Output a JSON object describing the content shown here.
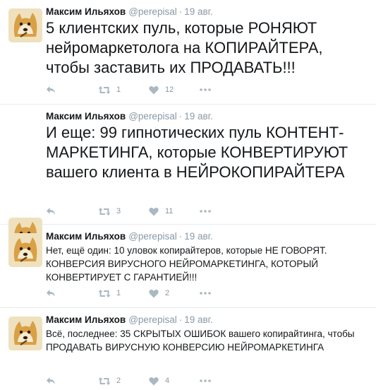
{
  "colors": {
    "meta": "#8899a6",
    "text": "#14171a",
    "divider": "#e6ecf0",
    "action": "#aab8c2"
  },
  "tweets": [
    {
      "author": "Максим Ильяхов",
      "handle": "@perepisal",
      "separator": "·",
      "date": "19 авг.",
      "text": "5 клиентских пуль, которые РОНЯЮТ нейромаркетолога на КОПИРАЙТЕРА, чтобы заставить их ПРОДАВАТЬ!!!",
      "retweets": "1",
      "likes": "12"
    },
    {
      "author": "Максим Ильяхов",
      "handle": "@perepisal",
      "separator": "·",
      "date": "19 авг.",
      "text": "И еще: 99 гипнотических пуль КОНТЕНТ-МАРКЕТИНГА, которые КОНВЕРТИРУЮТ вашего клиента в НЕЙРОКОПИРАЙТЕРА",
      "retweets": "3",
      "likes": "11"
    },
    {
      "author": "Максим Ильяхов",
      "handle": "@perepisal",
      "separator": "·",
      "date": "19 авг.",
      "text": "Нет, ещё один: 10 уловок копирайтеров, которые НЕ ГОВОРЯТ. КОНВЕРСИЯ ВИРУСНОГО НЕЙРОМАРКЕТИНГА, КОТОРЫЙ КОНВЕРТИРУЕТ С ГАРАНТИЕЙ!!!",
      "retweets": "1",
      "likes": "2"
    },
    {
      "author": "Максим Ильяхов",
      "handle": "@perepisal",
      "separator": "·",
      "date": "19 авг.",
      "text": "Всё, последнее: 35 СКРЫТЫХ ОШИБОК вашего копирайтинга, чтобы ПРОДАВАТЬ ВИРУСНУЮ КОНВЕРСИЮ НЕЙРОМАРКЕТИНГА",
      "retweets": "2",
      "likes": "4"
    }
  ],
  "icons": {
    "avatar": "doge-avatar",
    "reply": "reply-icon",
    "retweet": "retweet-icon",
    "like": "heart-icon",
    "more": "more-icon"
  }
}
